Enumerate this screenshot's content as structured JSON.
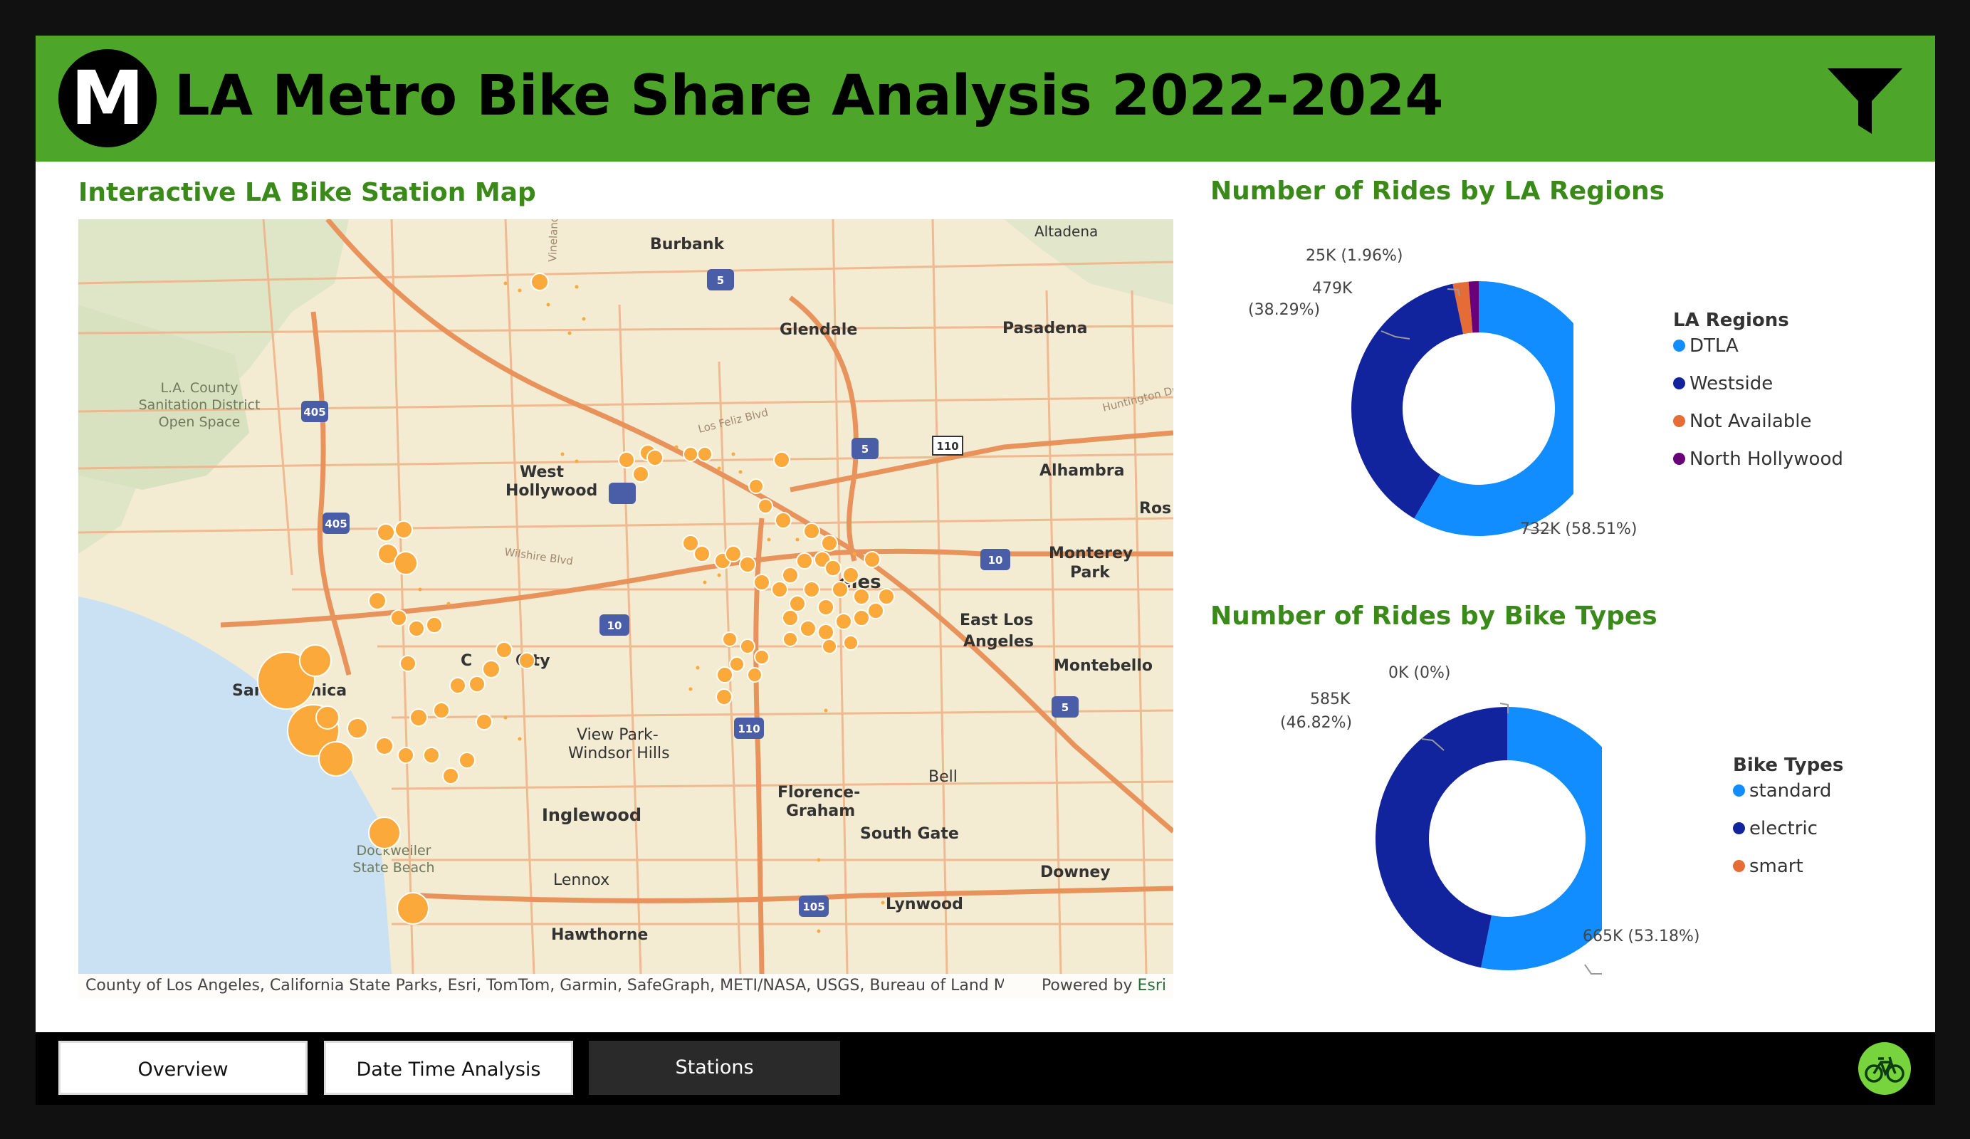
{
  "header": {
    "logo_letter": "M",
    "title": "LA Metro Bike Share Analysis 2022-2024",
    "accent_color": "#4da52a"
  },
  "map": {
    "title": "Interactive LA Bike Station Map",
    "attribution": "County of Los Angeles, California State Parks, Esri, TomTom, Garmin, SafeGraph, METI/NASA, USGS, Bureau of Land Manage...",
    "powered_by": "Powered by",
    "powered_by_brand": "Esri",
    "places": {
      "burbank": "Burbank",
      "altadena": "Altadena",
      "glendale": "Glendale",
      "pasadena": "Pasadena",
      "la_county": "L.A. County",
      "sanitation": "Sanitation District",
      "open_space": "Open Space",
      "west": "West",
      "hollywood": "Hollywood",
      "alhambra": "Alhambra",
      "ros": "Ros",
      "monterey": "Monterey",
      "park": "Park",
      "eles": "eles",
      "east_los": "East Los",
      "angeles": "Angeles",
      "montebello": "Montebello",
      "san": "San",
      "nica": "nica",
      "city": "City",
      "c": "C",
      "view_park": "View Park-",
      "windsor_hills": "Windsor Hills",
      "bell": "Bell",
      "florence": "Florence-",
      "graham": "Graham",
      "inglewood": "Inglewood",
      "south_gate": "South Gate",
      "dockweiler": "Dockweiler",
      "state_beach": "State Beach",
      "lennox": "Lennox",
      "downey": "Downey",
      "lynwood": "Lynwood",
      "hawthorne": "Hawthorne",
      "wilshire": "Wilshire Blvd",
      "los_feliz": "Los Feliz Blvd",
      "huntington": "Huntington Dr",
      "vineland": "Vineland",
      "fwy_405a": "405",
      "fwy_405b": "405",
      "fwy_5a": "5",
      "fwy_5b": "5",
      "fwy_5c": "5",
      "fwy_110a": "110",
      "fwy_110b": "110",
      "fwy_10a": "10",
      "fwy_10b": "10",
      "fwy_105": "105"
    },
    "station_color": "#fba93a"
  },
  "regions_chart": {
    "title": "Number of Rides by LA Regions",
    "legend_title": "LA Regions"
  },
  "bike_chart": {
    "title": "Number of Rides by Bike Types",
    "legend_title": "Bike Types"
  },
  "chart_data": [
    {
      "type": "pie",
      "title": "Number of Rides by LA Regions",
      "legend_title": "LA Regions",
      "legend_placement": "right",
      "categories": [
        "DTLA",
        "Westside",
        "Not Available",
        "North Hollywood"
      ],
      "values": [
        732000,
        479000,
        25000,
        16000
      ],
      "percentages": [
        58.51,
        38.29,
        1.96,
        1.24
      ],
      "data_labels": [
        "732K (58.51%)",
        "479K",
        "(38.29%)",
        "25K (1.96%)"
      ],
      "colors": [
        "#118dff",
        "#12239e",
        "#e66c37",
        "#6b007b"
      ]
    },
    {
      "type": "pie",
      "title": "Number of Rides by Bike Types",
      "legend_title": "Bike Types",
      "legend_placement": "right",
      "categories": [
        "standard",
        "electric",
        "smart"
      ],
      "values": [
        665000,
        585000,
        0
      ],
      "percentages": [
        53.18,
        46.82,
        0
      ],
      "data_labels": [
        "665K (53.18%)",
        "585K",
        "(46.82%)",
        "0K (0%)"
      ],
      "colors": [
        "#118dff",
        "#12239e",
        "#e66c37"
      ]
    }
  ],
  "nav": {
    "tabs": [
      {
        "label": "Overview"
      },
      {
        "label": "Date Time Analysis"
      },
      {
        "label": "Stations"
      }
    ],
    "bike_button_color": "#77d43d"
  }
}
